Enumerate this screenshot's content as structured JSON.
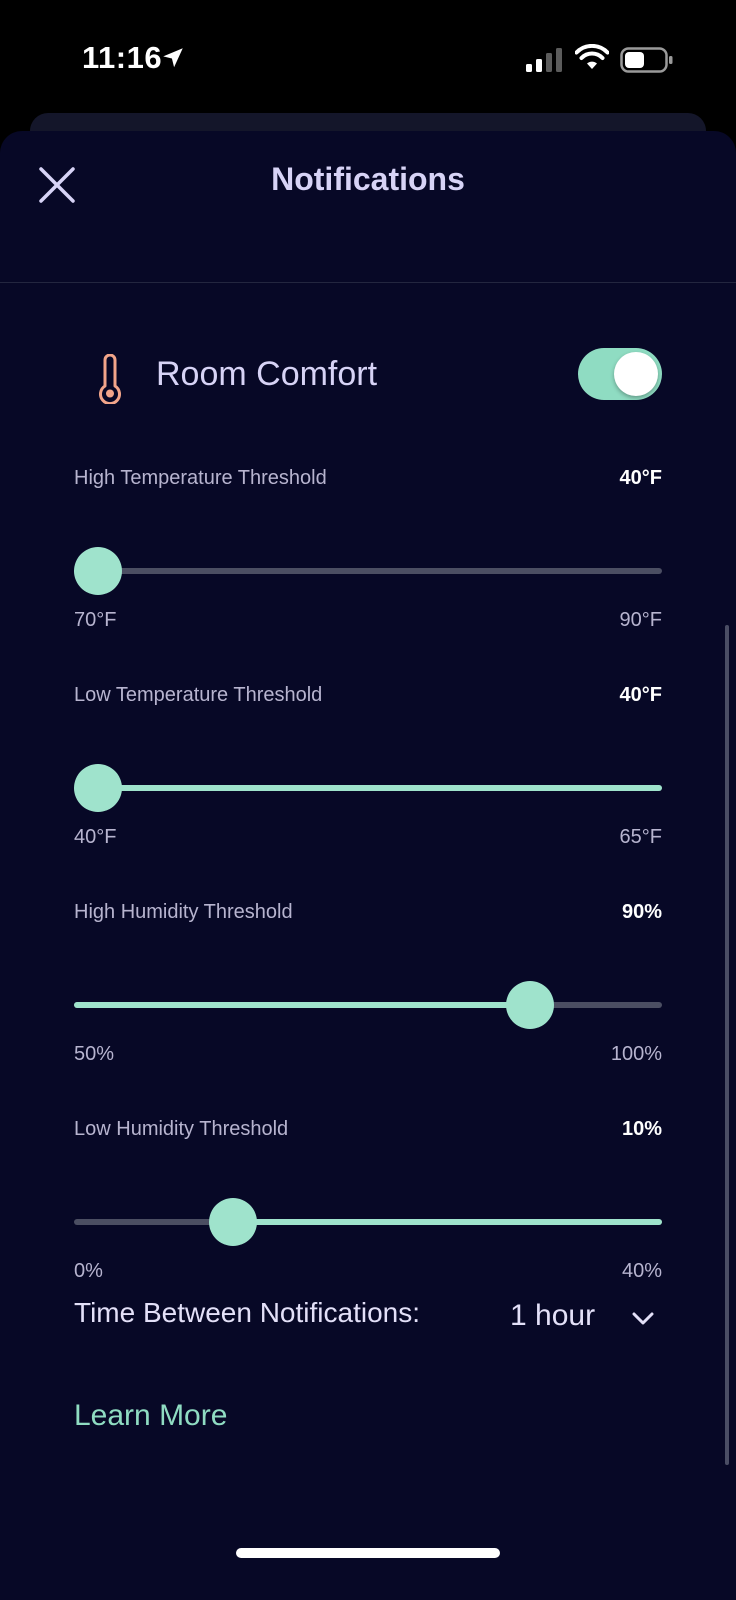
{
  "status_bar": {
    "time": "11:16"
  },
  "header": {
    "title": "Notifications",
    "close_icon": "close-icon"
  },
  "room_comfort": {
    "label": "Room Comfort",
    "icon": "thermometer-icon",
    "enabled": true,
    "accent_color": "#8fdcc2",
    "icon_color": "#f2a58a"
  },
  "thresholds": [
    {
      "label": "High Temperature Threshold",
      "value": "40°F",
      "min": "70°F",
      "max": "90°F",
      "fraction": 0.0,
      "fill_side": "left"
    },
    {
      "label": "Low Temperature Threshold",
      "value": "40°F",
      "min": "40°F",
      "max": "65°F",
      "fraction": 0.0,
      "fill_side": "right"
    },
    {
      "label": "High Humidity Threshold",
      "value": "90%",
      "min": "50%",
      "max": "100%",
      "fraction": 0.8,
      "fill_side": "left"
    },
    {
      "label": "Low Humidity Threshold",
      "value": "10%",
      "min": "0%",
      "max": "40%",
      "fraction": 0.25,
      "fill_side": "right"
    }
  ],
  "time_between": {
    "label": "Time Between Notifications:",
    "value": "1 hour"
  },
  "learn_more": "Learn More"
}
